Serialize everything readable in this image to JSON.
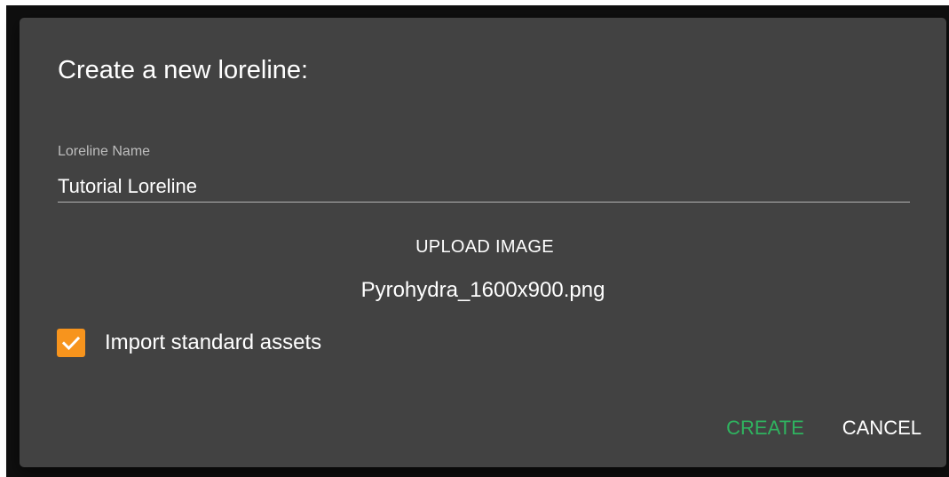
{
  "dialog": {
    "title": "Create a new loreline:",
    "name_field": {
      "label": "Loreline Name",
      "value": "Tutorial Loreline"
    },
    "upload_label": "UPLOAD IMAGE",
    "filename": "Pyrohydra_1600x900.png",
    "import_checkbox": {
      "label": "Import standard assets",
      "checked": true
    },
    "actions": {
      "create_label": "CREATE",
      "cancel_label": "CANCEL"
    }
  },
  "colors": {
    "dialog_background": "#424242",
    "accent_checkbox": "#f7941d",
    "create_text": "#2fb35f"
  },
  "icons": {
    "checkbox": "checkmark-icon"
  }
}
